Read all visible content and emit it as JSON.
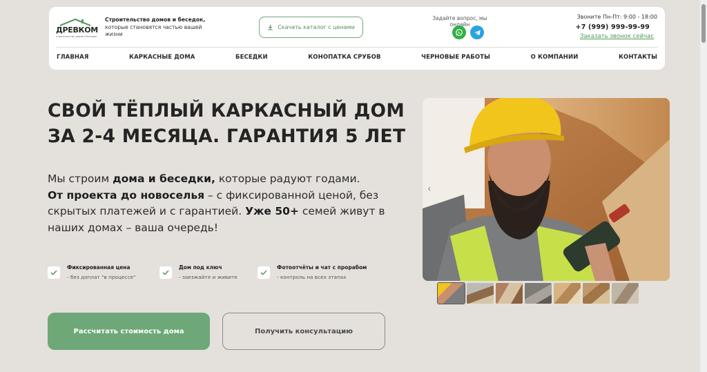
{
  "header": {
    "logo": {
      "name": "ДРЕВКОМ",
      "sub": "строительство домов и беседок"
    },
    "tagline": {
      "bold": "Строительство домов и беседок,",
      "rest": " которые становятся частью вашей жизни"
    },
    "catalog_button": "Скачать каталог с ценами",
    "ask_text": "Задайте вопрос, мы онлайн",
    "call_hours": "Звоните Пн-Пт: 9:00 - 18:00",
    "phone": "+7 (999) 999-99-99",
    "callback_link": "Заказать звонок сейчас",
    "nav": [
      "ГЛАВНАЯ",
      "КАРКАСНЫЕ ДОМА",
      "БЕСЕДКИ",
      "КОНОПАТКА СРУБОВ",
      "ЧЕРНОВЫЕ РАБОТЫ",
      "О КОМПАНИИ",
      "КОНТАКТЫ"
    ]
  },
  "hero": {
    "title_line1": "СВОЙ ТЁПЛЫЙ КАРКАСНЫЙ ДОМ",
    "title_line2": "ЗА 2-4 МЕСЯЦА. ГАРАНТИЯ 5 ЛЕТ",
    "text": {
      "p1": "Мы строим ",
      "b1": "дома и беседки,",
      "p2": " которые радуют годами.",
      "b2": "От проекта до новоселья",
      "p3": " – с фиксированной ценой, без скрытых платежей и с гарантией. ",
      "b3": "Уже 50+",
      "p4": " семей живут в наших домах – ваша очередь!"
    },
    "features": [
      {
        "title": "Фиксированная цена",
        "sub": "- без доплат \"в процессе\""
      },
      {
        "title": "Дом под ключ",
        "sub": "- заезжайте и живите"
      },
      {
        "title": "Фотоотчёты и чат с прорабом",
        "sub": "- контроль на всех этапах"
      }
    ],
    "primary_button": "Рассчитать стоимость дома",
    "secondary_button": "Получить консультацию"
  },
  "slider": {
    "arrow": "‹",
    "thumbnail_count": 7,
    "active_index": 0
  },
  "colors": {
    "background": "#e4e1dc",
    "accent_green": "#6ea878",
    "whatsapp": "#30b046",
    "telegram": "#2aa3df"
  }
}
